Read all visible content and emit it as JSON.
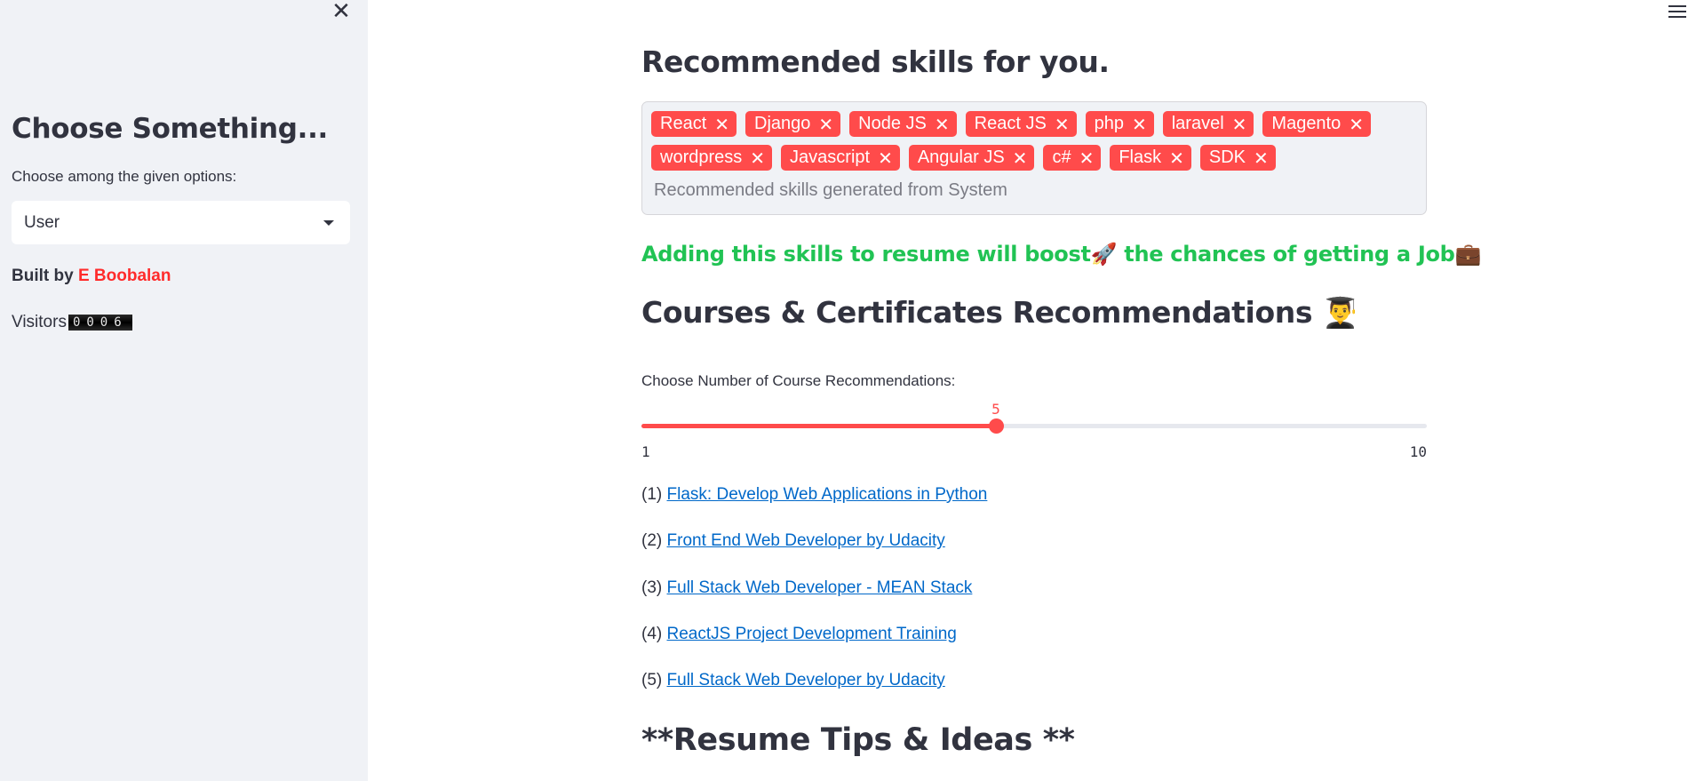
{
  "sidebar": {
    "close_icon": "close-icon",
    "title": "Choose Something...",
    "select_label": "Choose among the given options:",
    "select_value": "User",
    "built_by_prefix": "Built by",
    "author": "E Boobalan",
    "author_color": "#ff2b2b",
    "visitors_label": "Visitors",
    "visitors_count": "0006"
  },
  "header": {
    "menu_icon": "hamburger-menu-icon"
  },
  "main": {
    "skills_heading": "Recommended skills for you.",
    "skills": [
      "React",
      "Django",
      "Node JS",
      "React JS",
      "php",
      "laravel",
      "Magento",
      "wordpress",
      "Javascript",
      "Angular JS",
      "c#",
      "Flask",
      "SDK"
    ],
    "skills_placeholder": "Recommended skills generated from System",
    "boost_text": "Adding this skills to resume will boost",
    "boost_text_2": "the chances of getting a Job",
    "boost_emoji_1": "🚀",
    "boost_emoji_2": "💼",
    "courses_heading": "Courses & Certificates Recommendations",
    "courses_emoji": "👨‍🎓",
    "slider": {
      "label": "Choose Number of Course Recommendations:",
      "value": 5,
      "min": 1,
      "max": 10,
      "value_text": "5",
      "min_text": "1",
      "max_text": "10"
    },
    "courses": [
      {
        "num": "(1)",
        "title": "Flask: Develop Web Applications in Python"
      },
      {
        "num": "(2)",
        "title": "Front End Web Developer by Udacity"
      },
      {
        "num": "(3)",
        "title": "Full Stack Web Developer - MEAN Stack"
      },
      {
        "num": "(4)",
        "title": "ReactJS Project Development Training"
      },
      {
        "num": "(5)",
        "title": "Full Stack Web Developer by Udacity"
      }
    ],
    "tips_heading": "**Resume Tips & Ideas **"
  },
  "colors": {
    "accent": "#ff4b4b",
    "success": "#21c354",
    "link": "#0068c9",
    "sidebar_bg": "#f0f2f6"
  }
}
